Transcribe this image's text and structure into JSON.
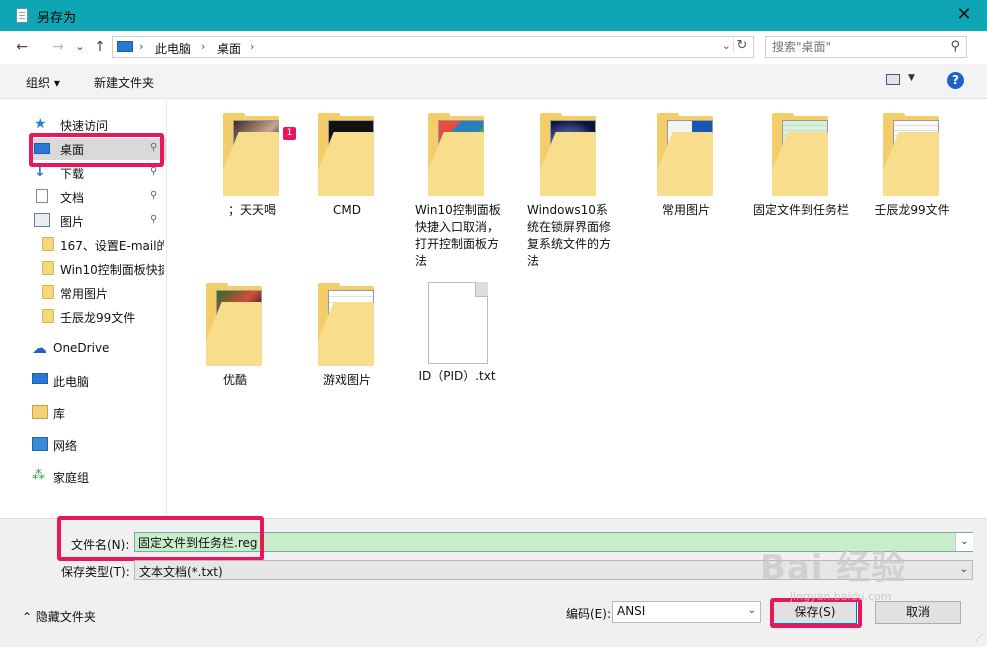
{
  "window": {
    "title": "另存为",
    "close_glyph": "✕",
    "title_bg": "#0ea5b5"
  },
  "nav": {
    "back": "←",
    "forward": "→",
    "recent": "⌄",
    "up": "↑"
  },
  "address": {
    "crumbs": [
      "此电脑",
      "桌面"
    ],
    "separator": "›",
    "dropdown": "⌄",
    "refresh": "↻"
  },
  "search": {
    "placeholder": "搜索\"桌面\"",
    "icon": "⚲"
  },
  "toolbar": {
    "organize": "组织 ▾",
    "new_folder": "新建文件夹",
    "view_dd": "▼",
    "help": "?"
  },
  "sidebar": {
    "items": [
      {
        "label": "快速访问",
        "icon": "star-icon"
      },
      {
        "label": "桌面",
        "icon": "desktop-icon",
        "pinned": true
      },
      {
        "label": "下载",
        "icon": "download-icon",
        "pinned": true
      },
      {
        "label": "文档",
        "icon": "document-icon",
        "pinned": true
      },
      {
        "label": "图片",
        "icon": "pictures-icon",
        "pinned": true
      },
      {
        "label": "167、设置E-mail的",
        "icon": "folder-icon"
      },
      {
        "label": "Win10控制面板快捷",
        "icon": "folder-icon"
      },
      {
        "label": "常用图片",
        "icon": "folder-icon"
      },
      {
        "label": "壬辰龙99文件",
        "icon": "folder-icon"
      },
      {
        "label": "OneDrive",
        "icon": "onedrive-icon"
      },
      {
        "label": "此电脑",
        "icon": "this-pc-icon"
      },
      {
        "label": "库",
        "icon": "library-icon"
      },
      {
        "label": "网络",
        "icon": "network-icon"
      },
      {
        "label": "家庭组",
        "icon": "homegroup-icon"
      }
    ],
    "pin_glyph": "📌"
  },
  "files": [
    {
      "name": "；天天喝",
      "type": "folder",
      "badge": "1"
    },
    {
      "name": "CMD",
      "type": "folder"
    },
    {
      "name": "Win10控制面板快捷入口取消，打开控制面板方法",
      "type": "folder"
    },
    {
      "name": "Windows10系统在锁屏界面修复系统文件的方法",
      "type": "folder"
    },
    {
      "name": "常用图片",
      "type": "folder"
    },
    {
      "name": "固定文件到任务栏",
      "type": "folder"
    },
    {
      "name": "壬辰龙99文件",
      "type": "folder"
    },
    {
      "name": "优酷",
      "type": "folder"
    },
    {
      "name": "游戏图片",
      "type": "folder"
    },
    {
      "name": "ID（PID）.txt",
      "type": "text-file"
    }
  ],
  "form": {
    "filename_label": "文件名(N):",
    "filename_value": "固定文件到任务栏.reg",
    "filetype_label": "保存类型(T):",
    "filetype_value": "文本文档(*.txt)",
    "encoding_label": "编码(E):",
    "encoding_value": "ANSI",
    "dropdown_glyph": "⌄"
  },
  "footer": {
    "hide_folders": "隐藏文件夹",
    "hide_glyph": "⌃",
    "save": "保存(S)",
    "cancel": "取消"
  },
  "watermark": {
    "text": "Bai 经验",
    "sub": "jingyan.baidu.com"
  },
  "colors": {
    "highlight": "#e8175d",
    "accent": "#0078d7",
    "filename_bg": "#c9ecc9"
  }
}
